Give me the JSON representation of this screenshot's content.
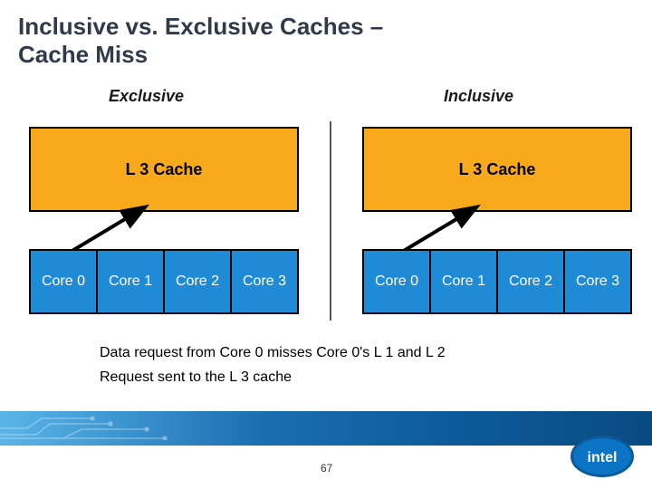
{
  "title_line1": "Inclusive vs. Exclusive Caches –",
  "title_line2": "Cache Miss",
  "left": {
    "heading": "Exclusive",
    "cache_label": "L 3 Cache",
    "cores": [
      "Core 0",
      "Core 1",
      "Core 2",
      "Core 3"
    ]
  },
  "right": {
    "heading": "Inclusive",
    "cache_label": "L 3 Cache",
    "cores": [
      "Core 0",
      "Core 1",
      "Core 2",
      "Core 3"
    ]
  },
  "bullets": [
    "Data request from Core 0 misses Core 0's L 1 and L 2",
    "Request sent to the L 3 cache"
  ],
  "page_number": "67",
  "logo_text": "intel"
}
